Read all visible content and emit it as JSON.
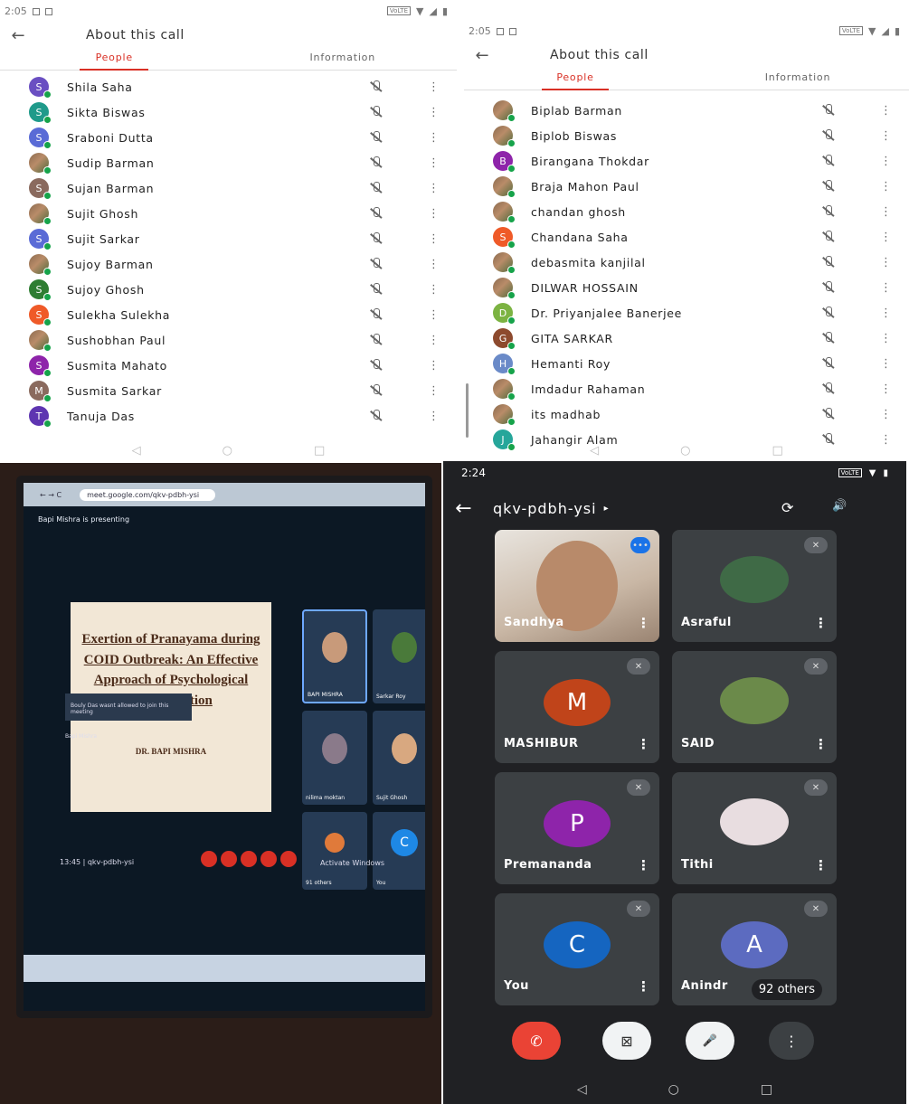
{
  "status_bar_light": {
    "time": "2:05",
    "network": "VoLTE"
  },
  "about_panel": {
    "title": "About this call",
    "back": "←",
    "tabs": [
      "People",
      "Information"
    ],
    "more": "⋮",
    "nav": [
      "◁",
      "○",
      "□"
    ]
  },
  "people_left": [
    {
      "initial": "S",
      "name": "Shila Saha",
      "color": "#6a4fc2",
      "photo": false
    },
    {
      "initial": "S",
      "name": "Sikta Biswas",
      "color": "#1f9a8a",
      "photo": false
    },
    {
      "initial": "S",
      "name": "Sraboni Dutta",
      "color": "#5a6bd6",
      "photo": false
    },
    {
      "initial": "",
      "name": "Sudip Barman",
      "color": "#7a5a44",
      "photo": true
    },
    {
      "initial": "S",
      "name": "Sujan Barman",
      "color": "#8a6a5e",
      "photo": false
    },
    {
      "initial": "",
      "name": "Sujit Ghosh",
      "color": "#c8955f",
      "photo": true
    },
    {
      "initial": "S",
      "name": "Sujit Sarkar",
      "color": "#5a6bd6",
      "photo": false
    },
    {
      "initial": "",
      "name": "Sujoy Barman",
      "color": "#6a7a4e",
      "photo": true
    },
    {
      "initial": "S",
      "name": "Sujoy Ghosh",
      "color": "#2e7d32",
      "photo": false
    },
    {
      "initial": "S",
      "name": "Sulekha Sulekha",
      "color": "#ef5a28",
      "photo": false
    },
    {
      "initial": "",
      "name": "Sushobhan Paul",
      "color": "#6a6a6a",
      "photo": true
    },
    {
      "initial": "S",
      "name": "Susmita Mahato",
      "color": "#8e24aa",
      "photo": false
    },
    {
      "initial": "M",
      "name": "Susmita Sarkar",
      "color": "#8a6a5e",
      "photo": false
    },
    {
      "initial": "T",
      "name": "Tanuja Das",
      "color": "#5e35b1",
      "photo": false
    }
  ],
  "people_right": [
    {
      "initial": "",
      "name": "Biplab Barman",
      "color": "#6a7a4e",
      "photo": true
    },
    {
      "initial": "",
      "name": "Biplob Biswas",
      "color": "#6a6a5a",
      "photo": true
    },
    {
      "initial": "B",
      "name": "Birangana Thokdar",
      "color": "#8e24aa",
      "photo": false
    },
    {
      "initial": "",
      "name": "Braja Mahon Paul",
      "color": "#b57a55",
      "photo": true
    },
    {
      "initial": "",
      "name": "chandan ghosh",
      "color": "#4a8ac8",
      "photo": true
    },
    {
      "initial": "S",
      "name": "Chandana Saha",
      "color": "#ef5a28",
      "photo": false
    },
    {
      "initial": "",
      "name": "debasmita kanjilal",
      "color": "#6a7a6a",
      "photo": true
    },
    {
      "initial": "",
      "name": "DILWAR HOSSAIN",
      "color": "#7a8a9a",
      "photo": true
    },
    {
      "initial": "D",
      "name": "Dr. Priyanjalee Banerjee",
      "color": "#7cb342",
      "photo": false
    },
    {
      "initial": "G",
      "name": "GITA SARKAR",
      "color": "#8d4a2e",
      "photo": false
    },
    {
      "initial": "H",
      "name": "Hemanti Roy",
      "color": "#6a8ac8",
      "photo": false
    },
    {
      "initial": "",
      "name": "Imdadur Rahaman",
      "color": "#b57a55",
      "photo": true
    },
    {
      "initial": "",
      "name": "its madhab",
      "color": "#d8b860",
      "photo": true
    },
    {
      "initial": "J",
      "name": "Jahangir Alam",
      "color": "#26a69a",
      "photo": false
    }
  ],
  "photo_panel": {
    "url": "meet.google.com/qkv-pdbh-ysi",
    "presenting": "Bapi Mishra is presenting",
    "slide_title": "Exertion of Pranayama during COID Outbreak: An Effective Approach of Psychological Rehabilitation",
    "slide_author": "DR. BAPI MISHRA",
    "tiles": [
      "BAPI MISHRA",
      "Sarkar Roy",
      "nilima moktan",
      "Sujit Ghosh",
      "91 others",
      "You"
    ],
    "toast": "Bouly Das wasnt allowed to join this meeting",
    "presenter_label": "Bapi Mishra",
    "meeting_time": "13:45 | qkv-pdbh-ysi",
    "watermark": "Activate Windows",
    "tile_letter": "C"
  },
  "meet": {
    "time": "2:24",
    "network": "VoLTE",
    "code": "qkv-pdbh-ysi",
    "caret": "▸",
    "participants": [
      {
        "name": "Sandhya",
        "letter": "",
        "kind": "video",
        "color": "#c9b7a5"
      },
      {
        "name": "Asraful",
        "letter": "",
        "kind": "photo",
        "color": "#3f6a46"
      },
      {
        "name": "MASHIBUR",
        "letter": "M",
        "kind": "letter",
        "color": "#c0441a"
      },
      {
        "name": "SAID",
        "letter": "",
        "kind": "photo",
        "color": "#6b8a4a"
      },
      {
        "name": "Premananda",
        "letter": "P",
        "kind": "letter",
        "color": "#8e24aa"
      },
      {
        "name": "Tithi",
        "letter": "",
        "kind": "photo",
        "color": "#e8dde0"
      },
      {
        "name": "You",
        "letter": "C",
        "kind": "letter",
        "color": "#1565c0"
      },
      {
        "name": "Anindr",
        "letter": "A",
        "kind": "letter",
        "color": "#5c6bc0"
      }
    ],
    "others": "92 others",
    "end_call": "✆",
    "camera_off": "⊠",
    "mic_off": "🎤",
    "more": "⋮",
    "back": "←",
    "switch_cam": "⟳",
    "speaker": "🔊",
    "nav": [
      "◁",
      "○",
      "□"
    ]
  }
}
